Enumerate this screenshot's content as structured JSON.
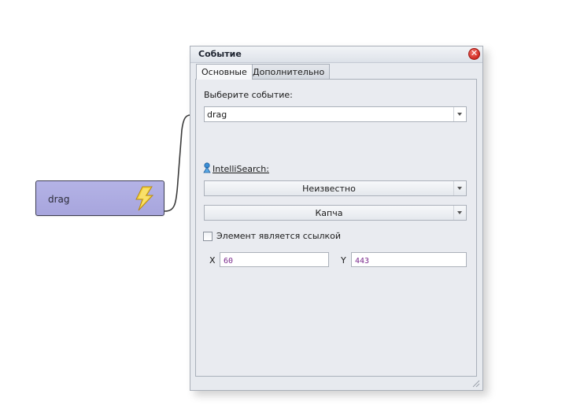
{
  "node": {
    "label": "drag",
    "icon": "lightning-icon"
  },
  "dialog": {
    "title": "Событие",
    "close_icon": "close-icon",
    "tabs": [
      {
        "label": "Основные",
        "active": true
      },
      {
        "label": "Дополнительно",
        "active": false
      }
    ],
    "event_label": "Выберите событие:",
    "event_value": "drag",
    "intellisearch_label": "IntelliSearch:",
    "combo1_value": "Неизвестно",
    "combo2_value": "Капча",
    "checkbox_label": "Элемент является ссылкой",
    "checkbox_checked": false,
    "x_label": "X",
    "x_value": "60",
    "y_label": "Y",
    "y_value": "443"
  },
  "colors": {
    "node_fill": "#aaa8e0",
    "node_border": "#3e3f55",
    "lightning": "#f4d23c",
    "close_button": "#d12a22",
    "coord_text": "#7a2a8c"
  }
}
